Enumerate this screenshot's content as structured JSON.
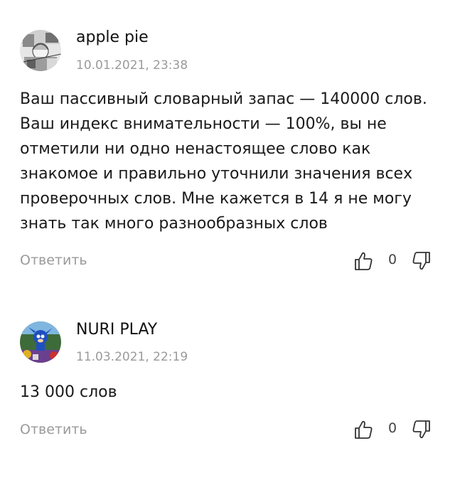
{
  "comments": [
    {
      "author": "apple pie",
      "timestamp": "10.01.2021, 23:38",
      "text": "Ваш пассивный словарный запас — 140000 слов. Ваш индекс внимательности — 100%, вы не отметили ни одно ненастоящее слово как знакомое и правильно уточнили значения всех проверочных слов. Мне кажется в 14 я не могу знать так много разнообразных слов",
      "reply_label": "Ответить",
      "vote_count": "0"
    },
    {
      "author": "NURI PLAY",
      "timestamp": "11.03.2021, 22:19",
      "text": "13 000 слов",
      "reply_label": "Ответить",
      "vote_count": "0"
    }
  ]
}
